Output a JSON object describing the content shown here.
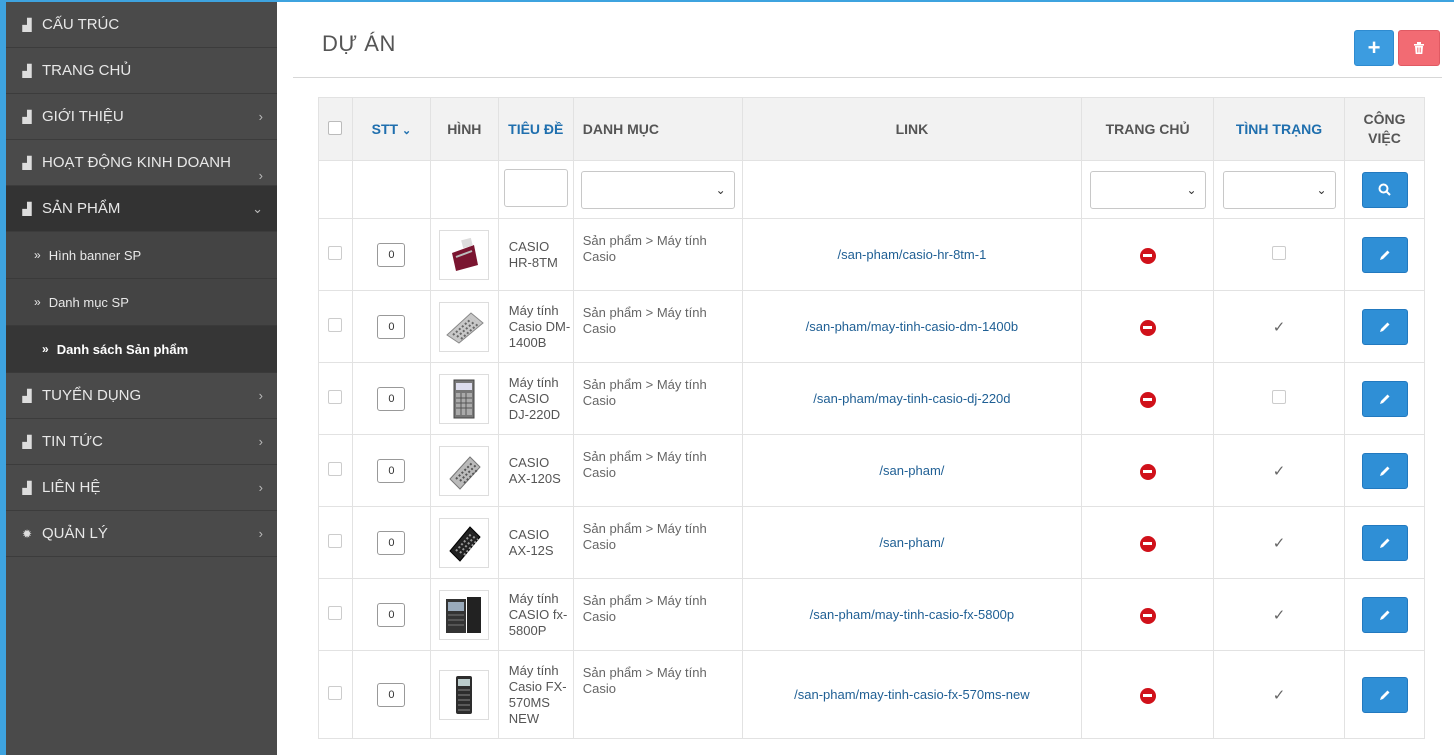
{
  "sidebar": {
    "items": [
      {
        "label": "CẤU TRÚC",
        "chev": ""
      },
      {
        "label": "TRANG CHỦ",
        "chev": ""
      },
      {
        "label": "GIỚI THIỆU",
        "chev": "›"
      },
      {
        "label": "HOẠT ĐỘNG KINH DOANH",
        "chev": "›"
      },
      {
        "label": "SẢN PHẨM",
        "chev": "⌄"
      },
      {
        "label": "TUYỂN DỤNG",
        "chev": "›"
      },
      {
        "label": "TIN TỨC",
        "chev": "›"
      },
      {
        "label": "LIÊN HỆ",
        "chev": "›"
      },
      {
        "label": "QUẢN LÝ",
        "chev": "›"
      }
    ],
    "subitems": [
      {
        "label": "Hình banner SP"
      },
      {
        "label": "Danh mục SP"
      },
      {
        "label": "Danh sách Sản phẩm"
      }
    ]
  },
  "header": {
    "title": "DỰ ÁN",
    "add_label": "+"
  },
  "table": {
    "columns": {
      "stt": "STT",
      "hinh": "HÌNH",
      "tieu_de": "TIÊU ĐỀ",
      "danh_muc": "DANH MỤC",
      "link": "LINK",
      "trang_chu": "TRANG CHỦ",
      "tinh_trang": "TÌNH TRẠNG",
      "cong_viec_1": "CÔNG",
      "cong_viec_2": "VIỆC"
    },
    "rows": [
      {
        "stt": "0",
        "title": [
          "CASIO",
          "HR-8TM"
        ],
        "category": [
          "Sản phẩm > Máy tính",
          "Casio"
        ],
        "link": "/san-pham/casio-hr-8tm-1",
        "checked": false
      },
      {
        "stt": "0",
        "title": [
          "Máy tính",
          "Casio DM-",
          "1400B"
        ],
        "category": [
          "Sản phẩm > Máy tính",
          "Casio"
        ],
        "link": "/san-pham/may-tinh-casio-dm-1400b",
        "checked": true
      },
      {
        "stt": "0",
        "title": [
          "Máy tính",
          "CASIO",
          "DJ-220D"
        ],
        "category": [
          "Sản phẩm > Máy tính",
          "Casio"
        ],
        "link": "/san-pham/may-tinh-casio-dj-220d",
        "checked": false
      },
      {
        "stt": "0",
        "title": [
          "CASIO",
          "AX-120S"
        ],
        "category": [
          "Sản phẩm > Máy tính",
          "Casio"
        ],
        "link": "/san-pham/",
        "checked": true
      },
      {
        "stt": "0",
        "title": [
          "CASIO",
          "AX-12S"
        ],
        "category": [
          "Sản phẩm > Máy tính",
          "Casio"
        ],
        "link": "/san-pham/",
        "checked": true
      },
      {
        "stt": "0",
        "title": [
          "Máy tính",
          "CASIO fx-",
          "5800P"
        ],
        "category": [
          "Sản phẩm > Máy tính",
          "Casio"
        ],
        "link": "/san-pham/may-tinh-casio-fx-5800p",
        "checked": true
      },
      {
        "stt": "0",
        "title": [
          "Máy tính",
          "Casio FX-",
          "570MS",
          "NEW"
        ],
        "category": [
          "Sản phẩm > Máy tính",
          "Casio"
        ],
        "link": "/san-pham/may-tinh-casio-fx-570ms-new",
        "checked": true
      }
    ]
  },
  "colors": {
    "accent": "#3c9ce0",
    "danger": "#f26b73",
    "sidebar": "#4a4a4a"
  }
}
